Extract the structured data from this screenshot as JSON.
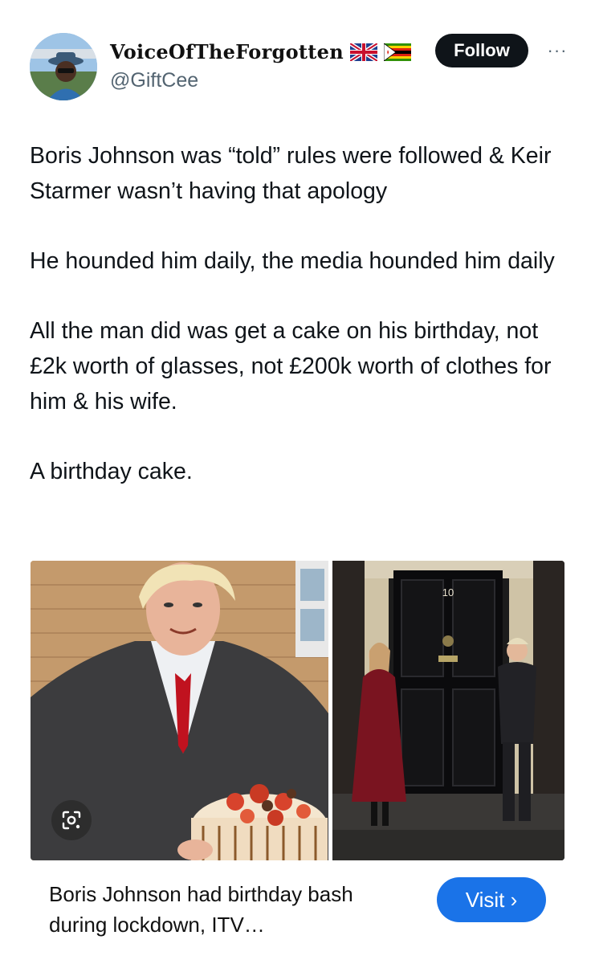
{
  "author": {
    "display_name": "VoiceOfTheForgotten",
    "flags": [
      "uk-flag-icon",
      "zimbabwe-flag-icon"
    ],
    "handle": "@GiftCee",
    "follow_label": "Follow",
    "more_label": "···"
  },
  "tweet": {
    "paragraphs": [
      "Boris Johnson was “told” rules were followed & Keir Starmer wasn’t having that apology",
      "He hounded him daily, the media hounded him daily",
      "All the man did was get a cake on his birthday, not £2k worth of glasses, not £200k worth of clothes for him & his wife.",
      "A birthday cake."
    ]
  },
  "card": {
    "door_number": "10",
    "title": "Boris Johnson had birthday bash during lockdown, ITV…",
    "visit_label": "Visit ›"
  },
  "colors": {
    "follow_bg": "#0f1419",
    "visit_bg": "#1a73e8",
    "handle": "#536471"
  }
}
